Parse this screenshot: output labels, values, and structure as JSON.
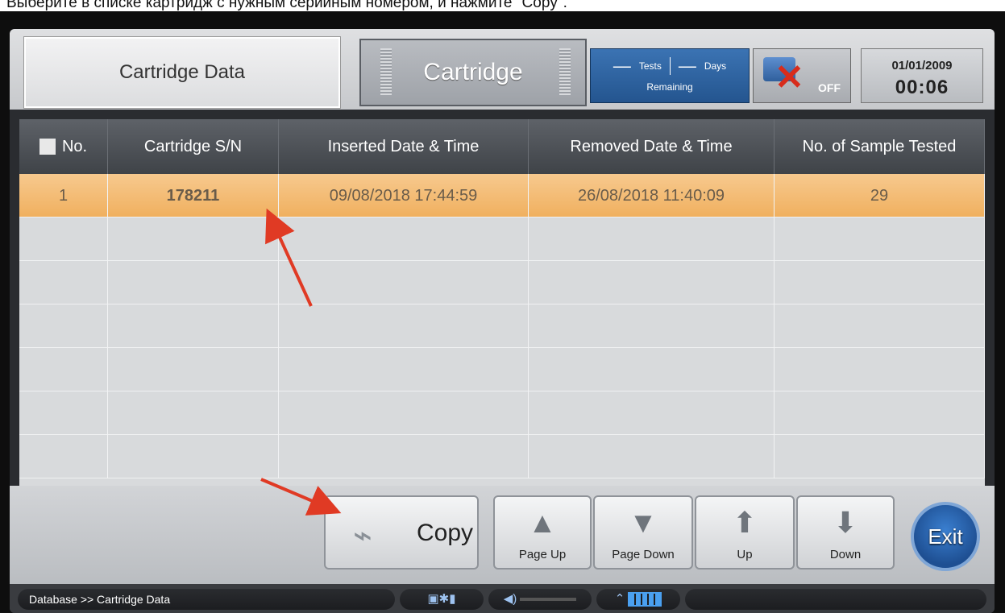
{
  "caption": "Выберите в списке картридж с нужным серийным номером, и нажмите \"Copy\".",
  "header": {
    "title": "Cartridge Data",
    "cartridge_label": "Cartridge",
    "remaining": {
      "tests_value": "—",
      "tests_label": "Tests",
      "days_value": "—",
      "days_label": "Days",
      "remaining_label": "Remaining"
    },
    "network_status": "OFF",
    "date": "01/01/2009",
    "time": "00:06"
  },
  "table": {
    "columns": [
      "No.",
      "Cartridge S/N",
      "Inserted Date & Time",
      "Removed Date & Time",
      "No. of Sample Tested"
    ],
    "rows": [
      {
        "no": "1",
        "sn": "178211",
        "inserted": "09/08/2018 17:44:59",
        "removed": "26/08/2018 11:40:09",
        "samples": "29",
        "selected": true
      }
    ],
    "empty_rows": 6
  },
  "toolbar": {
    "copy": "Copy",
    "page_up": "Page Up",
    "page_down": "Page Down",
    "up": "Up",
    "down": "Down",
    "exit": "Exit"
  },
  "status": {
    "breadcrumb": "Database >> Cartridge Data"
  },
  "colors": {
    "selected_row": "#f0b05f",
    "header_bar": "#3f4348",
    "accent_blue": "#2a62a8",
    "annotation_arrow": "#e03a24"
  }
}
